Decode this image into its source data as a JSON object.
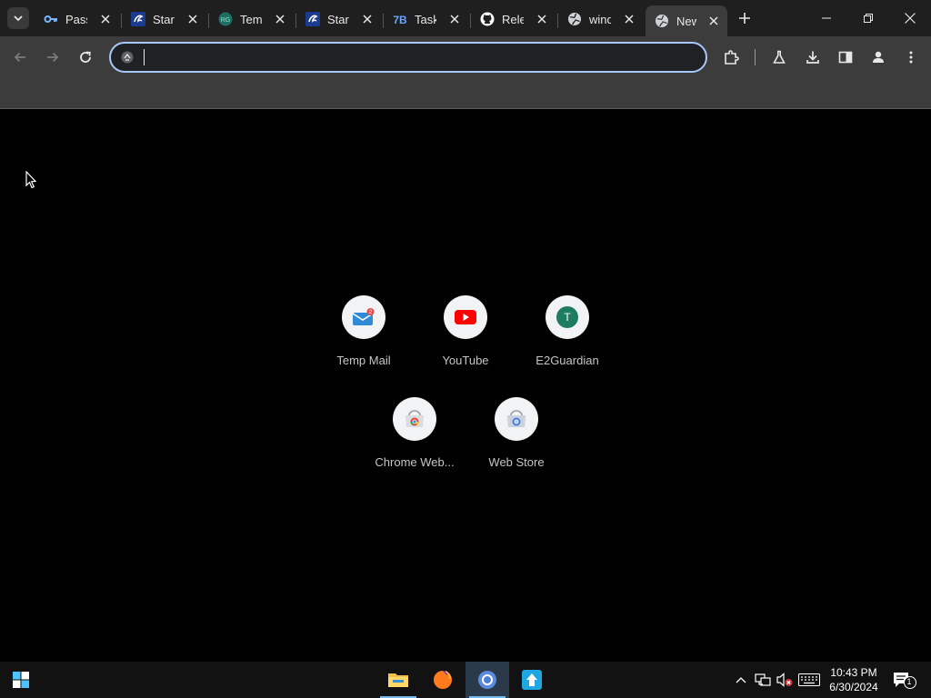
{
  "browser": {
    "tabs": [
      {
        "title": "Pass",
        "favicon": "key-icon",
        "active": false
      },
      {
        "title": "Start",
        "favicon": "link-icon",
        "active": false
      },
      {
        "title": "Temp",
        "favicon": "tempmail-icon",
        "active": false
      },
      {
        "title": "Start",
        "favicon": "link-icon",
        "active": false
      },
      {
        "title": "Tasks",
        "favicon": "tasks-icon",
        "active": false
      },
      {
        "title": "Rele",
        "favicon": "github-icon",
        "active": false
      },
      {
        "title": "wind",
        "favicon": "globe-icon",
        "active": false
      },
      {
        "title": "New",
        "favicon": "globe-icon",
        "active": true
      }
    ],
    "omnibox": {
      "value": "",
      "placeholder": ""
    }
  },
  "shortcuts": [
    {
      "label": "Temp Mail",
      "icon": "temp-mail-icon"
    },
    {
      "label": "YouTube",
      "icon": "youtube-icon"
    },
    {
      "label": "E2Guardian",
      "icon": "letter-t-icon",
      "letter": "T"
    },
    {
      "label": "Chrome Web...",
      "icon": "chrome-web-store-icon"
    },
    {
      "label": "Web Store",
      "icon": "web-store-icon"
    }
  ],
  "taskbar": {
    "time": "10:43 PM",
    "date": "6/30/2024",
    "notification_count": "1"
  },
  "colors": {
    "accent": "#a8c7fa",
    "tabstrip": "#1f1f1f",
    "toolbar": "#3c3c3c",
    "content": "#000000",
    "e2guardian": "#1e7d5f",
    "youtube": "#ff0000"
  }
}
